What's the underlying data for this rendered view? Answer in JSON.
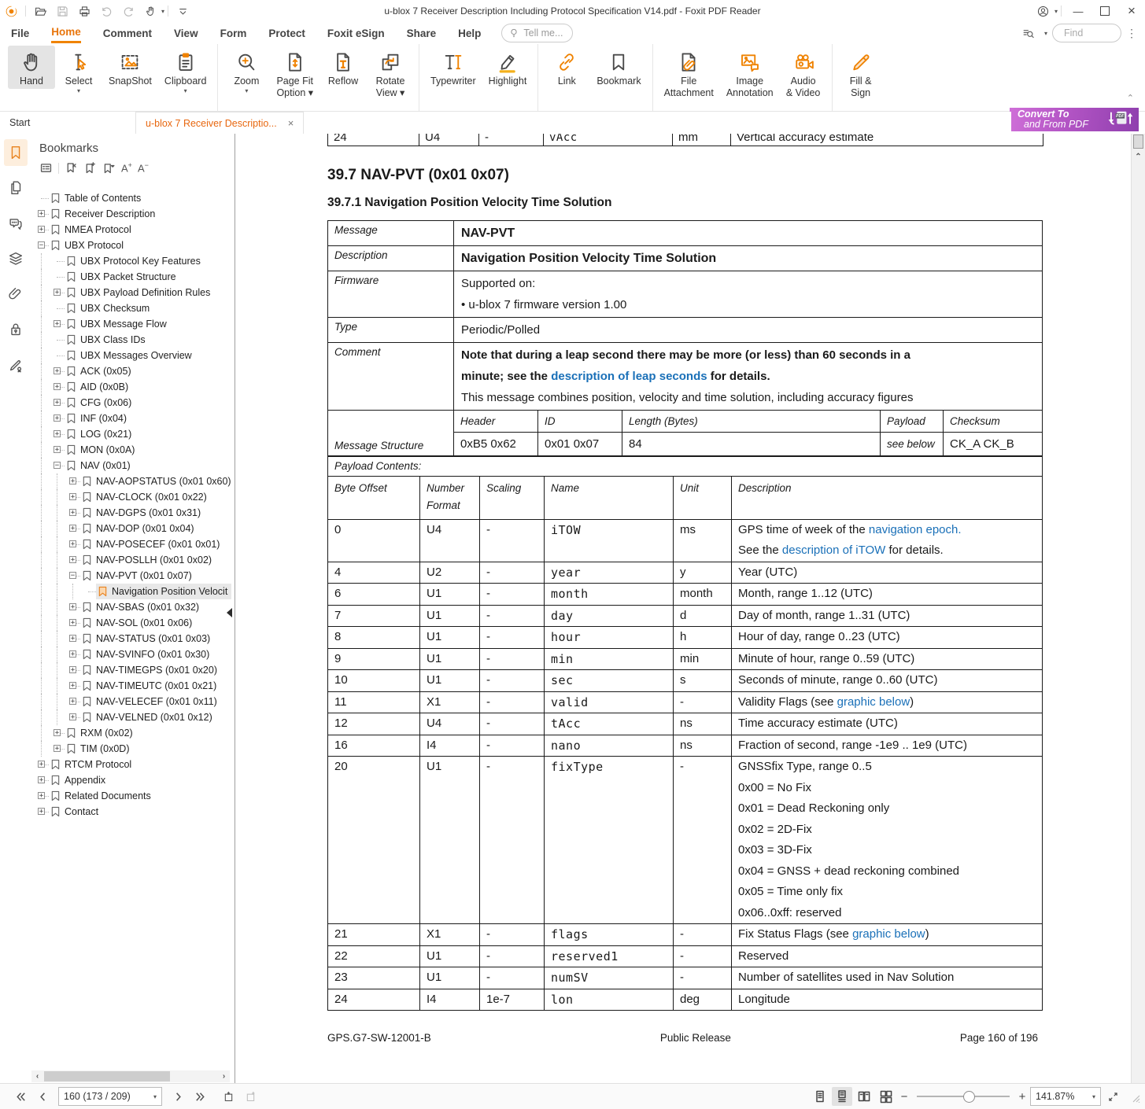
{
  "titlebar": {
    "title": "u-blox 7 Receiver Description Including Protocol Specification V14.pdf - Foxit PDF Reader"
  },
  "menubar": {
    "tabs": [
      "File",
      "Home",
      "Comment",
      "View",
      "Form",
      "Protect",
      "Foxit eSign",
      "Share",
      "Help"
    ],
    "active": "Home",
    "tellme": "Tell me...",
    "find_placeholder": "Find"
  },
  "ribbon": {
    "groups": [
      {
        "buttons": [
          {
            "label": [
              "Hand"
            ],
            "icon": "hand",
            "active": true
          },
          {
            "label": [
              "Select"
            ],
            "icon": "select",
            "caret": "below"
          },
          {
            "label": [
              "SnapShot"
            ],
            "icon": "snapshot"
          },
          {
            "label": [
              "Clipboard"
            ],
            "icon": "clipboard",
            "caret": "below"
          }
        ]
      },
      {
        "buttons": [
          {
            "label": [
              "Zoom"
            ],
            "icon": "zoomtool",
            "caret": "below"
          },
          {
            "label": [
              "Page Fit",
              "Option"
            ],
            "icon": "pagefit",
            "caret": "inline"
          },
          {
            "label": [
              "Reflow"
            ],
            "icon": "reflow"
          },
          {
            "label": [
              "Rotate",
              "View"
            ],
            "icon": "rotate",
            "caret": "inline"
          }
        ]
      },
      {
        "buttons": [
          {
            "label": [
              "Typewriter"
            ],
            "icon": "typewriter"
          },
          {
            "label": [
              "Highlight"
            ],
            "icon": "highlight"
          }
        ]
      },
      {
        "buttons": [
          {
            "label": [
              "Link"
            ],
            "icon": "link"
          },
          {
            "label": [
              "Bookmark"
            ],
            "icon": "bookmarkflag"
          }
        ]
      },
      {
        "buttons": [
          {
            "label": [
              "File",
              "Attachment"
            ],
            "icon": "fileattach"
          },
          {
            "label": [
              "Image",
              "Annotation"
            ],
            "icon": "imageannot"
          },
          {
            "label": [
              "Audio",
              "& Video"
            ],
            "icon": "audiovideo"
          }
        ]
      },
      {
        "buttons": [
          {
            "label": [
              "Fill &",
              "Sign"
            ],
            "icon": "fillsign"
          }
        ]
      }
    ]
  },
  "convert_banner": {
    "line1": "Convert To",
    "line2": "and From PDF"
  },
  "doc_tabs": [
    {
      "label": "Start",
      "active": false,
      "closable": false
    },
    {
      "label": "u-blox 7 Receiver Descriptio...",
      "active": true,
      "closable": true
    }
  ],
  "bookmarks": {
    "title": "Bookmarks",
    "tree": [
      {
        "label": "Table of Contents",
        "lvl": 0,
        "tog": "none"
      },
      {
        "label": "Receiver Description",
        "lvl": 0,
        "tog": "plus"
      },
      {
        "label": "NMEA Protocol",
        "lvl": 0,
        "tog": "plus"
      },
      {
        "label": "UBX Protocol",
        "lvl": 0,
        "tog": "minus"
      },
      {
        "label": "UBX Protocol Key Features",
        "lvl": 1,
        "tog": "none"
      },
      {
        "label": "UBX Packet Structure",
        "lvl": 1,
        "tog": "none"
      },
      {
        "label": "UBX Payload Definition Rules",
        "lvl": 1,
        "tog": "plus"
      },
      {
        "label": "UBX Checksum",
        "lvl": 1,
        "tog": "none"
      },
      {
        "label": "UBX Message Flow",
        "lvl": 1,
        "tog": "plus"
      },
      {
        "label": "UBX Class IDs",
        "lvl": 1,
        "tog": "none"
      },
      {
        "label": "UBX Messages Overview",
        "lvl": 1,
        "tog": "none"
      },
      {
        "label": "ACK (0x05)",
        "lvl": 1,
        "tog": "plus"
      },
      {
        "label": "AID (0x0B)",
        "lvl": 1,
        "tog": "plus"
      },
      {
        "label": "CFG (0x06)",
        "lvl": 1,
        "tog": "plus"
      },
      {
        "label": "INF (0x04)",
        "lvl": 1,
        "tog": "plus"
      },
      {
        "label": "LOG (0x21)",
        "lvl": 1,
        "tog": "plus"
      },
      {
        "label": "MON (0x0A)",
        "lvl": 1,
        "tog": "plus"
      },
      {
        "label": "NAV (0x01)",
        "lvl": 1,
        "tog": "minus"
      },
      {
        "label": "NAV-AOPSTATUS (0x01 0x60)",
        "lvl": 2,
        "tog": "plus"
      },
      {
        "label": "NAV-CLOCK (0x01 0x22)",
        "lvl": 2,
        "tog": "plus"
      },
      {
        "label": "NAV-DGPS (0x01 0x31)",
        "lvl": 2,
        "tog": "plus"
      },
      {
        "label": "NAV-DOP (0x01 0x04)",
        "lvl": 2,
        "tog": "plus"
      },
      {
        "label": "NAV-POSECEF (0x01 0x01)",
        "lvl": 2,
        "tog": "plus"
      },
      {
        "label": "NAV-POSLLH (0x01 0x02)",
        "lvl": 2,
        "tog": "plus"
      },
      {
        "label": "NAV-PVT (0x01 0x07)",
        "lvl": 2,
        "tog": "minus"
      },
      {
        "label": "Navigation Position Velocit",
        "lvl": 3,
        "tog": "none",
        "sel": true
      },
      {
        "label": "NAV-SBAS (0x01 0x32)",
        "lvl": 2,
        "tog": "plus"
      },
      {
        "label": "NAV-SOL (0x01 0x06)",
        "lvl": 2,
        "tog": "plus"
      },
      {
        "label": "NAV-STATUS (0x01 0x03)",
        "lvl": 2,
        "tog": "plus"
      },
      {
        "label": "NAV-SVINFO (0x01 0x30)",
        "lvl": 2,
        "tog": "plus"
      },
      {
        "label": "NAV-TIMEGPS (0x01 0x20)",
        "lvl": 2,
        "tog": "plus"
      },
      {
        "label": "NAV-TIMEUTC (0x01 0x21)",
        "lvl": 2,
        "tog": "plus"
      },
      {
        "label": "NAV-VELECEF (0x01 0x11)",
        "lvl": 2,
        "tog": "plus"
      },
      {
        "label": "NAV-VELNED (0x01 0x12)",
        "lvl": 2,
        "tog": "plus"
      },
      {
        "label": "RXM (0x02)",
        "lvl": 1,
        "tog": "plus"
      },
      {
        "label": "TIM (0x0D)",
        "lvl": 1,
        "tog": "plus"
      },
      {
        "label": "RTCM Protocol",
        "lvl": 0,
        "tog": "plus"
      },
      {
        "label": "Appendix",
        "lvl": 0,
        "tog": "plus"
      },
      {
        "label": "Related Documents",
        "lvl": 0,
        "tog": "plus"
      },
      {
        "label": "Contact",
        "lvl": 0,
        "tog": "plus"
      }
    ]
  },
  "document": {
    "partial_row": {
      "offset": "24",
      "format": "U4",
      "scaling": "-",
      "name": "vAcc",
      "unit": "mm",
      "desc": "Vertical accuracy estimate"
    },
    "heading1": "39.7 NAV-PVT (0x01 0x07)",
    "heading2": "39.7.1 Navigation Position Velocity Time Solution",
    "info_rows": [
      {
        "label": "Message",
        "big": true,
        "lines": [
          [
            {
              "t": "NAV-PVT"
            }
          ]
        ]
      },
      {
        "label": "Description",
        "big": true,
        "lines": [
          [
            {
              "t": "Navigation Position Velocity Time Solution"
            }
          ]
        ]
      },
      {
        "label": "Firmware",
        "lines": [
          [
            {
              "t": "Supported on:"
            }
          ],
          [
            {
              "t": "•  u-blox 7 firmware version 1.00"
            }
          ]
        ]
      },
      {
        "label": "Type",
        "lines": [
          [
            {
              "t": "Periodic/Polled"
            }
          ]
        ]
      },
      {
        "label": "Comment",
        "lines": [
          [
            {
              "t": "Note that during a leap second there may be more (or less) than 60 seconds in a",
              "b": true
            }
          ],
          [
            {
              "t": "minute; see the ",
              "b": true
            },
            {
              "t": "description of leap seconds",
              "b": true,
              "link": true
            },
            {
              "t": " for details.",
              "b": true
            }
          ],
          [
            {
              "t": "This message combines position, velocity and time solution, including accuracy figures"
            }
          ]
        ]
      }
    ],
    "structure": {
      "row_label": "Message Structure",
      "headers": [
        "Header",
        "ID",
        "Length (Bytes)",
        "Payload",
        "Checksum"
      ],
      "values": [
        "0xB5 0x62",
        "0x01 0x07",
        "84",
        "see below",
        "CK_A CK_B"
      ],
      "italic_values": [
        3
      ]
    },
    "payload_title": "Payload Contents:",
    "payload_headers": [
      [
        "Byte Offset"
      ],
      [
        "Number",
        "Format"
      ],
      [
        "Scaling"
      ],
      [
        "Name"
      ],
      [
        "Unit"
      ],
      [
        "Description"
      ]
    ],
    "payload_rows": [
      {
        "offset": "0",
        "format": "U4",
        "scaling": "-",
        "name": "iTOW",
        "unit": "ms",
        "desc": [
          [
            {
              "t": "GPS time of week of the "
            },
            {
              "t": "navigation epoch.",
              "link": true
            }
          ],
          [
            {
              "t": "See the "
            },
            {
              "t": "description of iTOW",
              "link": true
            },
            {
              "t": " for details."
            }
          ]
        ]
      },
      {
        "offset": "4",
        "format": "U2",
        "scaling": "-",
        "name": "year",
        "unit": "y",
        "desc": [
          [
            {
              "t": "Year (UTC)"
            }
          ]
        ]
      },
      {
        "offset": "6",
        "format": "U1",
        "scaling": "-",
        "name": "month",
        "unit": "month",
        "desc": [
          [
            {
              "t": "Month, range 1..12 (UTC)"
            }
          ]
        ]
      },
      {
        "offset": "7",
        "format": "U1",
        "scaling": "-",
        "name": "day",
        "unit": "d",
        "desc": [
          [
            {
              "t": "Day of month, range 1..31 (UTC)"
            }
          ]
        ]
      },
      {
        "offset": "8",
        "format": "U1",
        "scaling": "-",
        "name": "hour",
        "unit": "h",
        "desc": [
          [
            {
              "t": "Hour of day, range 0..23 (UTC)"
            }
          ]
        ]
      },
      {
        "offset": "9",
        "format": "U1",
        "scaling": "-",
        "name": "min",
        "unit": "min",
        "desc": [
          [
            {
              "t": "Minute of hour, range 0..59 (UTC)"
            }
          ]
        ]
      },
      {
        "offset": "10",
        "format": "U1",
        "scaling": "-",
        "name": "sec",
        "unit": "s",
        "desc": [
          [
            {
              "t": "Seconds of minute, range 0..60 (UTC)"
            }
          ]
        ]
      },
      {
        "offset": "11",
        "format": "X1",
        "scaling": "-",
        "name": "valid",
        "unit": "-",
        "desc": [
          [
            {
              "t": "Validity Flags (see "
            },
            {
              "t": "graphic below",
              "link": true
            },
            {
              "t": ")"
            }
          ]
        ]
      },
      {
        "offset": "12",
        "format": "U4",
        "scaling": "-",
        "name": "tAcc",
        "unit": "ns",
        "desc": [
          [
            {
              "t": "Time accuracy estimate (UTC)"
            }
          ]
        ]
      },
      {
        "offset": "16",
        "format": "I4",
        "scaling": "-",
        "name": "nano",
        "unit": "ns",
        "desc": [
          [
            {
              "t": "Fraction of second, range -1e9 .. 1e9 (UTC)"
            }
          ]
        ]
      },
      {
        "offset": "20",
        "format": "U1",
        "scaling": "-",
        "name": "fixType",
        "unit": "-",
        "desc": [
          [
            {
              "t": "GNSSfix Type, range 0..5"
            }
          ],
          [
            {
              "t": "0x00 = No Fix"
            }
          ],
          [
            {
              "t": "0x01 = Dead Reckoning only"
            }
          ],
          [
            {
              "t": "0x02 = 2D-Fix"
            }
          ],
          [
            {
              "t": "0x03 = 3D-Fix"
            }
          ],
          [
            {
              "t": "0x04 = GNSS + dead reckoning combined"
            }
          ],
          [
            {
              "t": "0x05 = Time only fix"
            }
          ],
          [
            {
              "t": "0x06..0xff: reserved"
            }
          ]
        ]
      },
      {
        "offset": "21",
        "format": "X1",
        "scaling": "-",
        "name": "flags",
        "unit": "-",
        "desc": [
          [
            {
              "t": "Fix Status Flags (see "
            },
            {
              "t": "graphic below",
              "link": true
            },
            {
              "t": ")"
            }
          ]
        ]
      },
      {
        "offset": "22",
        "format": "U1",
        "scaling": "-",
        "name": "reserved1",
        "unit": "-",
        "desc": [
          [
            {
              "t": "Reserved"
            }
          ]
        ]
      },
      {
        "offset": "23",
        "format": "U1",
        "scaling": "-",
        "name": "numSV",
        "unit": "-",
        "desc": [
          [
            {
              "t": "Number of satellites used in Nav Solution"
            }
          ]
        ]
      },
      {
        "offset": "24",
        "format": "I4",
        "scaling": "1e-7",
        "name": "lon",
        "unit": "deg",
        "desc": [
          [
            {
              "t": "Longitude"
            }
          ]
        ]
      }
    ],
    "footer": {
      "left": "GPS.G7-SW-12001-B",
      "center": "Public Release",
      "right": "Page 160 of 196"
    }
  },
  "statusbar": {
    "page_field": "160 (173 / 209)",
    "zoom_value": "141.87%"
  },
  "colors": {
    "accent_orange": "#ef8200",
    "link_blue": "#1a70b8",
    "convert_purple": "#b254c4"
  }
}
